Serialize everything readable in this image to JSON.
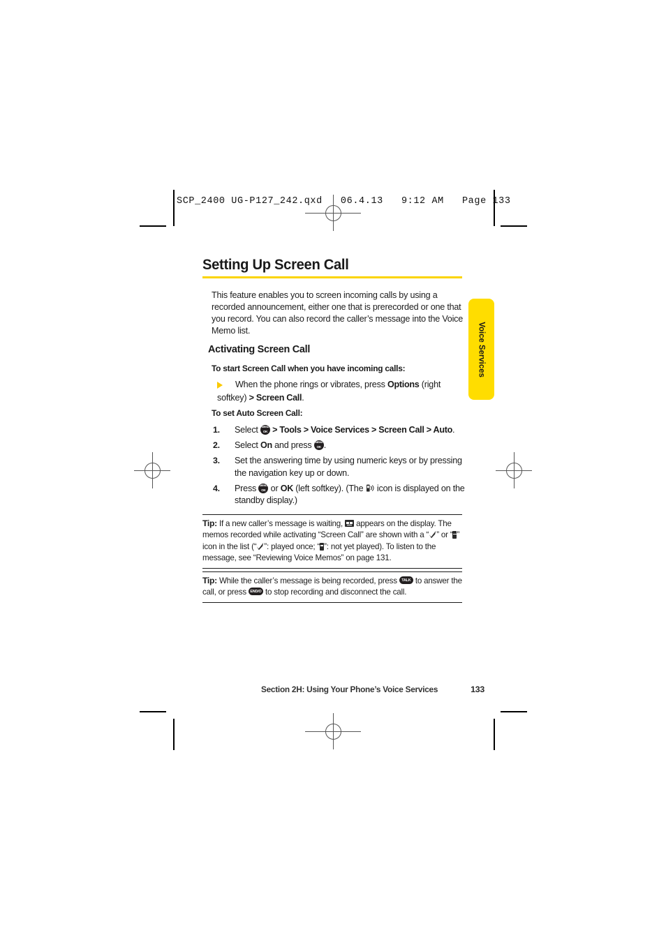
{
  "prepress": {
    "qxd_header": "SCP_2400 UG-P127_242.qxd   06.4.13   9:12 AM   Page 133"
  },
  "page": {
    "title": "Setting Up Screen Call",
    "intro": "This feature enables you to screen incoming calls by using a recorded announcement, either one that is prerecorded or one that you record. You can also record the caller’s message into the Voice Memo list.",
    "section_heading": "Activating Screen Call",
    "lead_1": "To start Screen Call when you have incoming calls:",
    "bullet": {
      "text_1": "When the phone rings or vibrates, press ",
      "bold_1": "Options",
      "text_2": " (right softkey) ",
      "bold_2": "> Screen Call",
      "text_3": "."
    },
    "lead_2": "To set Auto Screen Call:",
    "steps": [
      {
        "num": "1.",
        "text_1": "Select ",
        "icon": "menu-ok-key-icon",
        "bold_1": " > Tools > Voice Services > Screen Call > Auto",
        "text_2": "."
      },
      {
        "num": "2.",
        "text_1": "Select ",
        "bold_1": "On",
        "text_2": " and press ",
        "icon": "menu-ok-key-icon",
        "text_3": "."
      },
      {
        "num": "3.",
        "text_1": "Set the answering time by using numeric keys or by pressing the navigation key up or down.",
        "bold_1": "",
        "text_2": ""
      },
      {
        "num": "4.",
        "text_1": "Press ",
        "icon": "menu-ok-key-icon",
        "text_2": " or ",
        "bold_1": "OK",
        "text_3": " (left softkey). (The ",
        "icon2": "screen-call-standby-icon",
        "text_4": " icon is displayed on the standby display.)"
      }
    ],
    "tips": [
      {
        "label": "Tip:",
        "t1": " If a new caller’s message is waiting, ",
        "icon1": "new-message-envelope-icon",
        "t2": " appears on the display. The memos recorded while activating “Screen Call” are shown with a “",
        "icon2": "played-check-icon",
        "t3": "” or “",
        "icon3": "unplayed-tape-icon",
        "t4": "” icon in the list (“",
        "icon4": "played-check-icon",
        "t5": "”: played once; “",
        "icon5": "unplayed-tape-icon",
        "t6": "”: not yet played). To listen to the message, see “Reviewing Voice Memos” on page 131."
      },
      {
        "label": "Tip:",
        "t1": " While the caller’s message is being recorded, press ",
        "icon1": "talk-key-icon",
        "t2": " to answer the call, or press ",
        "icon2": "end-key-icon",
        "t3": " to stop recording and disconnect the call."
      }
    ],
    "side_tab_label": "Voice Services",
    "footer": {
      "section": "Section 2H: Using Your Phone’s Voice Services",
      "page_number": "133"
    }
  },
  "keys": {
    "menu_ok_top": "MENU",
    "menu_ok_bottom": "OK",
    "talk": "TALK",
    "end": "END/O"
  },
  "colors": {
    "accent_yellow": "#fbd400",
    "tab_yellow": "#ffdd00",
    "bullet_gold": "#fbc900",
    "text": "#1a1a1a"
  }
}
